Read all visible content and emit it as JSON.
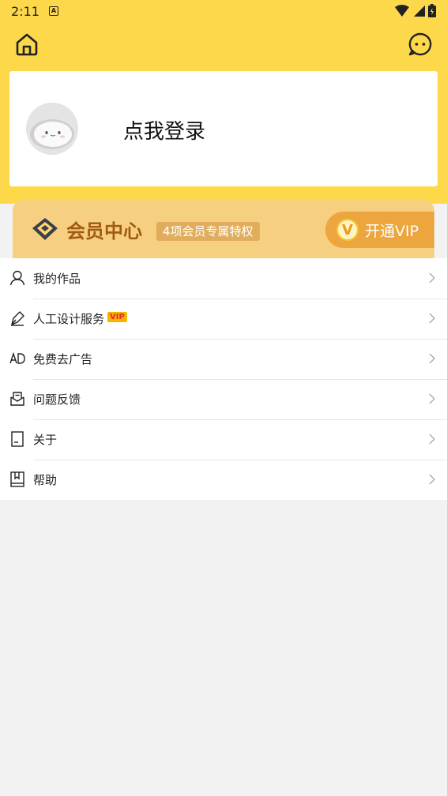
{
  "status_bar": {
    "time": "2:11",
    "badge": "A"
  },
  "login": {
    "text": "点我登录"
  },
  "vip": {
    "title": "会员中心",
    "tag": "4项会员专属特权",
    "open_button_symbol": "V",
    "open_button_label": "开通VIP"
  },
  "menu": {
    "items": [
      {
        "label": "我的作品",
        "icon": "person-icon"
      },
      {
        "label": "人工设计服务",
        "icon": "pen-icon",
        "badge": "VIP"
      },
      {
        "label": "免费去广告",
        "icon": "ad-icon"
      },
      {
        "label": "问题反馈",
        "icon": "feedback-icon"
      },
      {
        "label": "关于",
        "icon": "document-icon"
      },
      {
        "label": "帮助",
        "icon": "book-icon"
      }
    ]
  },
  "colors": {
    "header_yellow": "#fdd84a",
    "vip_banner": "#f7cf80",
    "vip_title": "#a15a13",
    "vip_button": "#eda53d"
  }
}
